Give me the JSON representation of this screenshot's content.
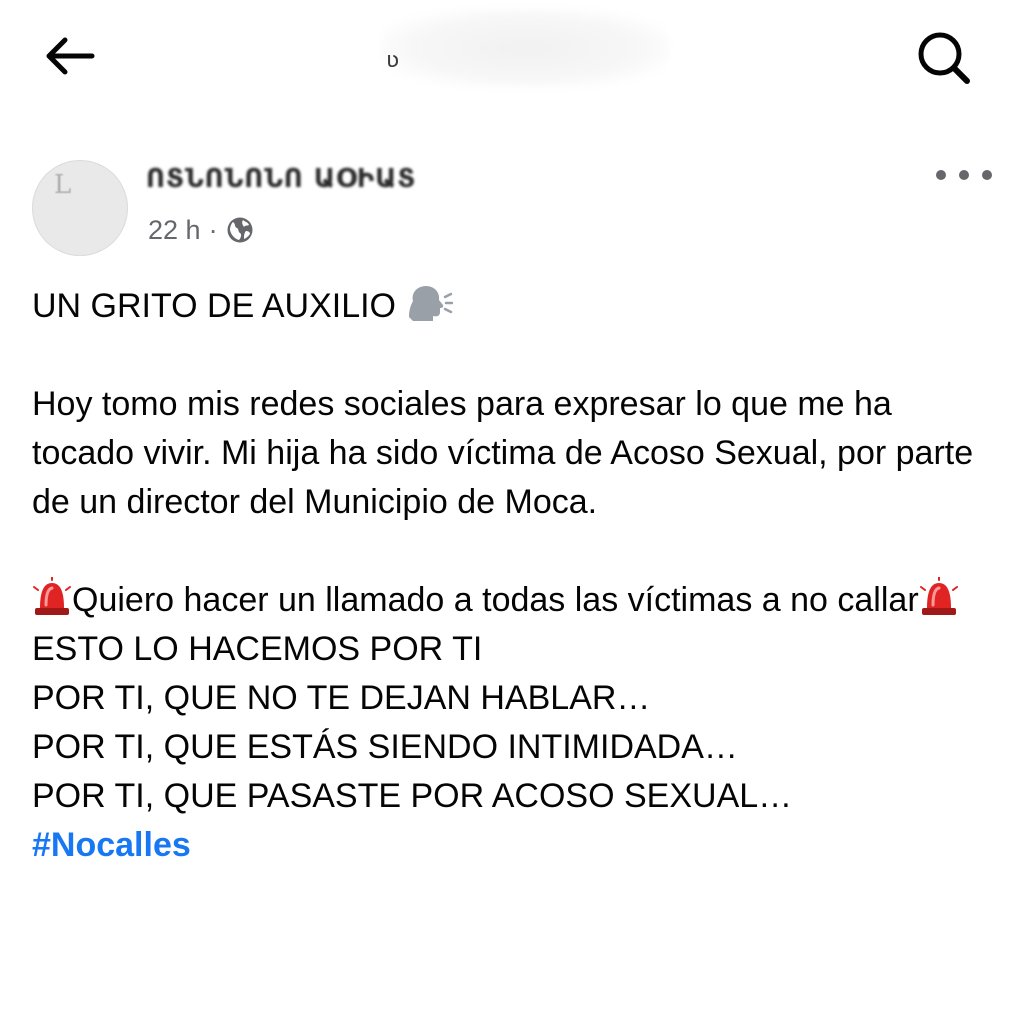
{
  "header": {
    "back_icon": "arrow-left-icon",
    "search_icon": "search-icon",
    "title_glyph": "ʋ"
  },
  "post": {
    "author_name": "ՈՏՆՈՆՈՆՈ ԱՕԻԱՏ",
    "time": "22 h",
    "separator": "·",
    "audience_icon": "globe-icon",
    "more_icon": "more-dots-icon",
    "paragraphs": {
      "title": "UN GRITO DE AUXILIO",
      "title_icon": "speaking-head-icon",
      "body": "Hoy tomo mis redes sociales para expresar lo que me ha tocado vivir. Mi hija ha sido víctima de Acoso Sexual, por parte de un director del Municipio de Moca.",
      "call_icon": "police-light-icon",
      "call_text_1": "Quiero hacer un llamado a todas las víctimas a no callar",
      "line_1": "ESTO LO HACEMOS POR TI",
      "line_2": "POR TI, QUE NO TE DEJAN HABLAR…",
      "line_3": "POR TI, QUE ESTÁS SIENDO INTIMIDADA…",
      "line_4": "POR TI, QUE PASASTE POR ACOSO SEXUAL…",
      "hashtag": "#Nocalles"
    }
  },
  "colors": {
    "link": "#1877f2",
    "meta": "#65676b",
    "text": "#050505"
  }
}
